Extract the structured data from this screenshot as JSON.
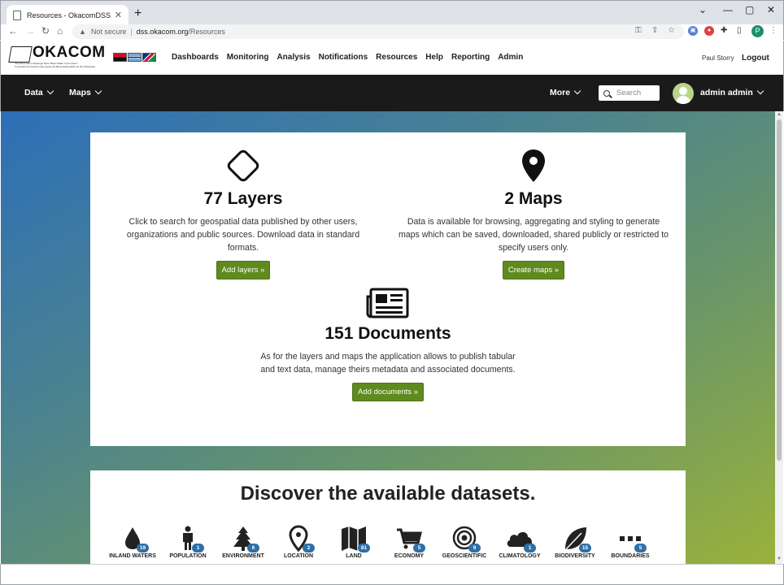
{
  "browser": {
    "tab_title": "Resources - OkacomDSS",
    "new_tab": "+",
    "not_secure": "Not secure",
    "url_host": "dss.okacom.org",
    "url_path": "/Resources",
    "profile_initial": "P"
  },
  "site": {
    "logo_name": "OKACOM",
    "logo_sub1": "The Permanent Okavango River Basin Water Commission",
    "logo_sub2": "Comissão Permanente das Águas da Bacia Hidrográfica do Rio Okavango",
    "nav": [
      "Dashboards",
      "Monitoring",
      "Analysis",
      "Notifications",
      "Resources",
      "Help",
      "Reporting",
      "Admin"
    ],
    "user_name": "Paul Storry",
    "logout": "Logout"
  },
  "darknav": {
    "data": "Data",
    "maps": "Maps",
    "more": "More",
    "search_placeholder": "Search",
    "user": "admin admin"
  },
  "features": {
    "layers": {
      "title": "77 Layers",
      "text": "Click to search for geospatial data published by other users, organizations and public sources. Download data in standard formats.",
      "button": "Add layers »"
    },
    "maps": {
      "title": "2 Maps",
      "text": "Data is available for browsing, aggregating and styling to generate maps which can be saved, downloaded, shared publicly or restricted to specify users only.",
      "button": "Create maps »"
    },
    "documents": {
      "title": "151 Documents",
      "text": "As for the layers and maps the application allows to publish tabular and text data, manage theirs metadata and associated documents.",
      "button": "Add documents »"
    }
  },
  "discover": {
    "title": "Discover the available datasets.",
    "categories": [
      {
        "label": "INLAND WATERS",
        "count": "19",
        "icon": "drop-icon"
      },
      {
        "label": "POPULATION",
        "count": "1",
        "icon": "person-icon"
      },
      {
        "label": "ENVIRONMENT",
        "count": "6",
        "icon": "tree-icon"
      },
      {
        "label": "LOCATION",
        "count": "2",
        "icon": "map-pin-icon"
      },
      {
        "label": "LAND",
        "count": "81",
        "icon": "folded-map-icon"
      },
      {
        "label": "ECONOMY",
        "count": "5",
        "icon": "cart-icon"
      },
      {
        "label": "GEOSCIENTIFIC",
        "count": "9",
        "icon": "target-icon"
      },
      {
        "label": "CLIMATOLOGY",
        "count": "1",
        "icon": "cloud-icon"
      },
      {
        "label": "BIODIVERSITY",
        "count": "15",
        "icon": "leaf-icon"
      },
      {
        "label": "BOUNDARIES",
        "count": "5",
        "icon": "dots-icon"
      }
    ]
  },
  "colors": {
    "button_green": "#5f8a1e",
    "badge_blue": "#2f6fa6",
    "dark_nav": "#1a1a1a"
  }
}
